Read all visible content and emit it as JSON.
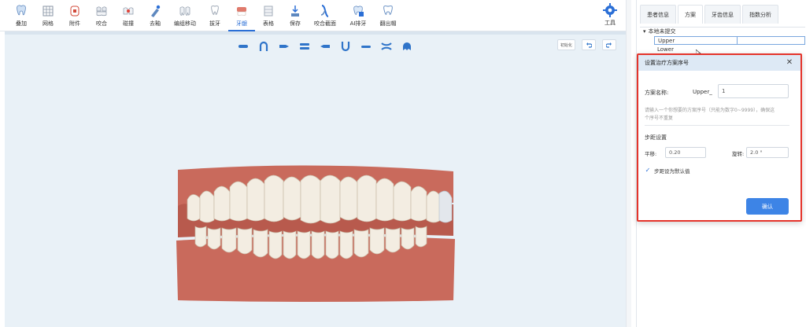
{
  "toolbar": {
    "items": [
      {
        "label": "叠加",
        "icon": "tooth-stack-icon"
      },
      {
        "label": "网格",
        "icon": "grid-icon"
      },
      {
        "label": "附件",
        "icon": "attachment-icon"
      },
      {
        "label": "咬合",
        "icon": "occlusion-icon"
      },
      {
        "label": "碰撞",
        "icon": "collision-icon"
      },
      {
        "label": "去釉",
        "icon": "enamel-brush-icon"
      },
      {
        "label": "编组移动",
        "icon": "group-move-icon"
      },
      {
        "label": "拔牙",
        "icon": "extraction-icon"
      },
      {
        "label": "牙龈",
        "icon": "gum-icon"
      },
      {
        "label": "表格",
        "icon": "table-icon"
      },
      {
        "label": "保存",
        "icon": "save-icon"
      },
      {
        "label": "咬合截面",
        "icon": "section-icon"
      },
      {
        "label": "AI排牙",
        "icon": "ai-arrange-icon"
      },
      {
        "label": "翻出帽",
        "icon": "cap-icon"
      }
    ],
    "tools_label": "工具"
  },
  "viewport": {
    "view_buttons": [
      "front-view-icon",
      "upper-arch-icon",
      "right-view-icon",
      "center-view-icon",
      "left-view-icon",
      "lower-arch-icon",
      "bottom-view-icon",
      "split-view-icon",
      "occlusal-view-icon"
    ],
    "corner_label": "初始化"
  },
  "right_panel": {
    "tabs": [
      "患者信息",
      "方案",
      "牙齿信息",
      "指数分析"
    ],
    "tree": {
      "root": "本地未提交",
      "rows": [
        "Upper",
        "Lower"
      ]
    }
  },
  "dialog": {
    "title": "设置治疗方案序号",
    "name_label": "方案名称:",
    "name_prefix": "Upper_",
    "name_value": "1",
    "hint": "请输入一个你想要的方案序号（只能为数字0~9999），确保这个序号不重复",
    "step_section": "步距设置",
    "translate_label": "平移:",
    "translate_value": "0.20",
    "rotate_label": "旋转:",
    "rotate_value": "2.0 °",
    "default_checkbox": "步距设为默认值",
    "ok_label": "确认"
  },
  "colors": {
    "accent": "#3d84e6",
    "highlight_border": "#e5332a",
    "viewport_bg": "#e9f1f7",
    "gum": "#c96a5c"
  }
}
